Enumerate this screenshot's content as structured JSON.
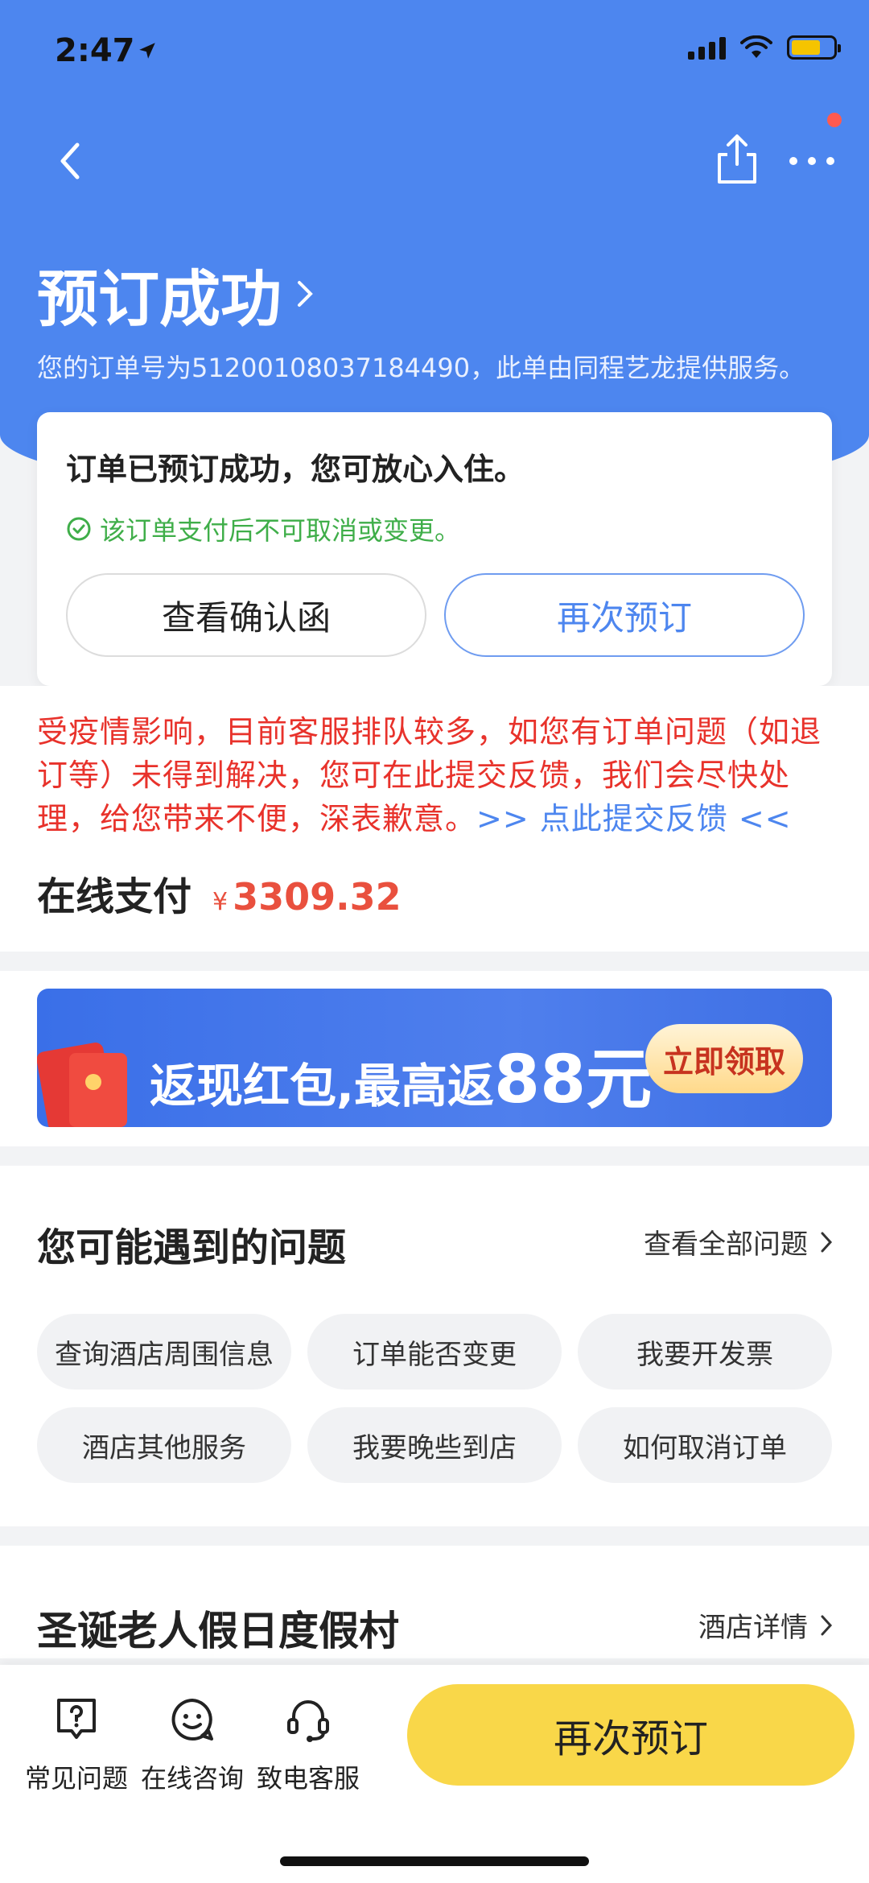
{
  "status": {
    "time": "2:47"
  },
  "header": {
    "title": "预订成功",
    "order_line": "您的订单号为51200108037184490，此单由同程艺龙提供服务。"
  },
  "status_card": {
    "title": "订单已预订成功，您可放心入住。",
    "note": "该订单支付后不可取消或变更。",
    "confirm_label": "查看确认函",
    "rebook_label": "再次预订"
  },
  "notice": {
    "text": "受疫情影响，目前客服排队较多，如您有订单问题（如退订等）未得到解决，您可在此提交反馈，我们会尽快处理，给您带来不便，深表歉意。",
    "link": ">> 点此提交反馈 <<"
  },
  "payment": {
    "label": "在线支付",
    "currency": "¥",
    "amount": "3309.32"
  },
  "banner": {
    "text_prefix": "返现红包,最高返",
    "text_amount": "88元",
    "button": "立即领取"
  },
  "faq": {
    "title": "您可能遇到的问题",
    "view_all": "查看全部问题",
    "chips": [
      "查询酒店周围信息",
      "订单能否变更",
      "我要开发票",
      "酒店其他服务",
      "我要晚些到店",
      "如何取消订单"
    ]
  },
  "hotel": {
    "name": "圣诞老人假日度假村",
    "detail_link": "酒店详情"
  },
  "bottom": {
    "tools": [
      {
        "label": "常见问题",
        "icon": "question-bubble-icon"
      },
      {
        "label": "在线咨询",
        "icon": "chat-smile-icon"
      },
      {
        "label": "致电客服",
        "icon": "headset-icon"
      }
    ],
    "rebook": "再次预订"
  },
  "colors": {
    "brand_blue": "#4d86ef",
    "alert_red": "#e8322b",
    "success_green": "#3fae49",
    "cta_yellow": "#f9d749",
    "price_red": "#e9503e"
  }
}
